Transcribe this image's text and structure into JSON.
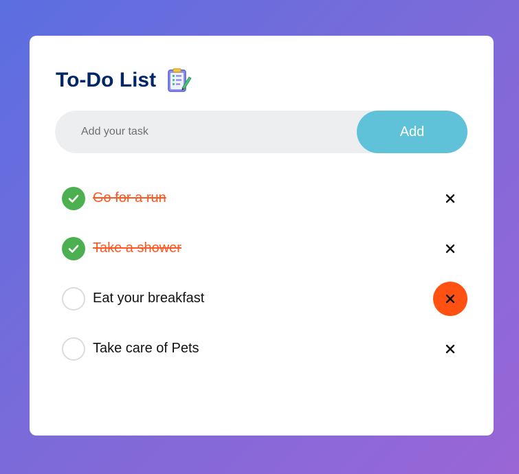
{
  "app": {
    "title": "To-Do List",
    "title_icon": "clipboard-checklist-icon"
  },
  "input": {
    "placeholder": "Add your task",
    "value": "",
    "add_label": "Add"
  },
  "tasks": [
    {
      "label": "Go for a run",
      "checked": true
    },
    {
      "label": "Take a shower",
      "checked": true
    },
    {
      "label": "Eat your breakfast",
      "checked": false,
      "hovered": true
    },
    {
      "label": "Take care of Pets",
      "checked": false
    }
  ],
  "colors": {
    "title": "#002765",
    "add_button": "#5fc2d9",
    "checked": "#4caf50",
    "completed_text": "#ff5722",
    "delete_hover": "#ff5212"
  }
}
